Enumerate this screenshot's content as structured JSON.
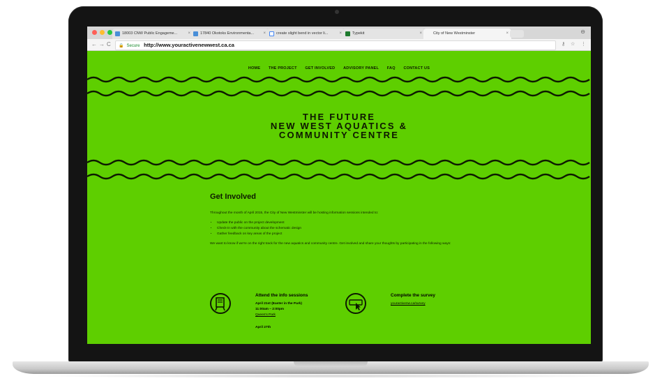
{
  "browser": {
    "tabs": [
      {
        "label": "18003 CNW Public Engageme..."
      },
      {
        "label": "17840 Okotoks Environmenta..."
      },
      {
        "label": "create slight bend in vector li..."
      },
      {
        "label": "Typekit"
      },
      {
        "label": "City of New Westminster"
      }
    ],
    "secure_label": "Secure",
    "url": "http://www.youractivenewwest.ca.ca",
    "colors": {
      "traffic_red": "#ff5f57",
      "traffic_yellow": "#ffbd2e",
      "traffic_green": "#28c840"
    }
  },
  "site": {
    "accent_color": "#5ecf00",
    "nav": [
      "HOME",
      "THE PROJECT",
      "GET INVOLVED",
      "ADVISORY PANEL",
      "FAQ",
      "CONTACT US"
    ],
    "hero": [
      "THE FUTURE",
      "NEW WEST AQUATICS &",
      "COMMUNITY CENTRE"
    ],
    "section_title": "Get Involved",
    "intro": "Throughout the month of April 2015, the City of New Westminster will be hosting information sessions intended to:",
    "bullets": [
      "Update the public on the project development",
      "Check-in with the community about the schematic design",
      "Gather feedback on key areas of the project"
    ],
    "cta_text": "We want to know if we're on the right track for the new aquatics and community centre. Get involved and share your thoughts by participating in the following ways:",
    "info": {
      "icon": "calendar-icon",
      "title": "Attend the info sessions",
      "date1": "April 21st (Easter in the Park)",
      "time1": "11:00am – 2:00pm",
      "place1": "Queen's Park",
      "date2": "April 27th"
    },
    "survey": {
      "icon": "survey-cursor-icon",
      "title": "Complete the survey",
      "link": "youractivenw.ca/survey"
    }
  }
}
